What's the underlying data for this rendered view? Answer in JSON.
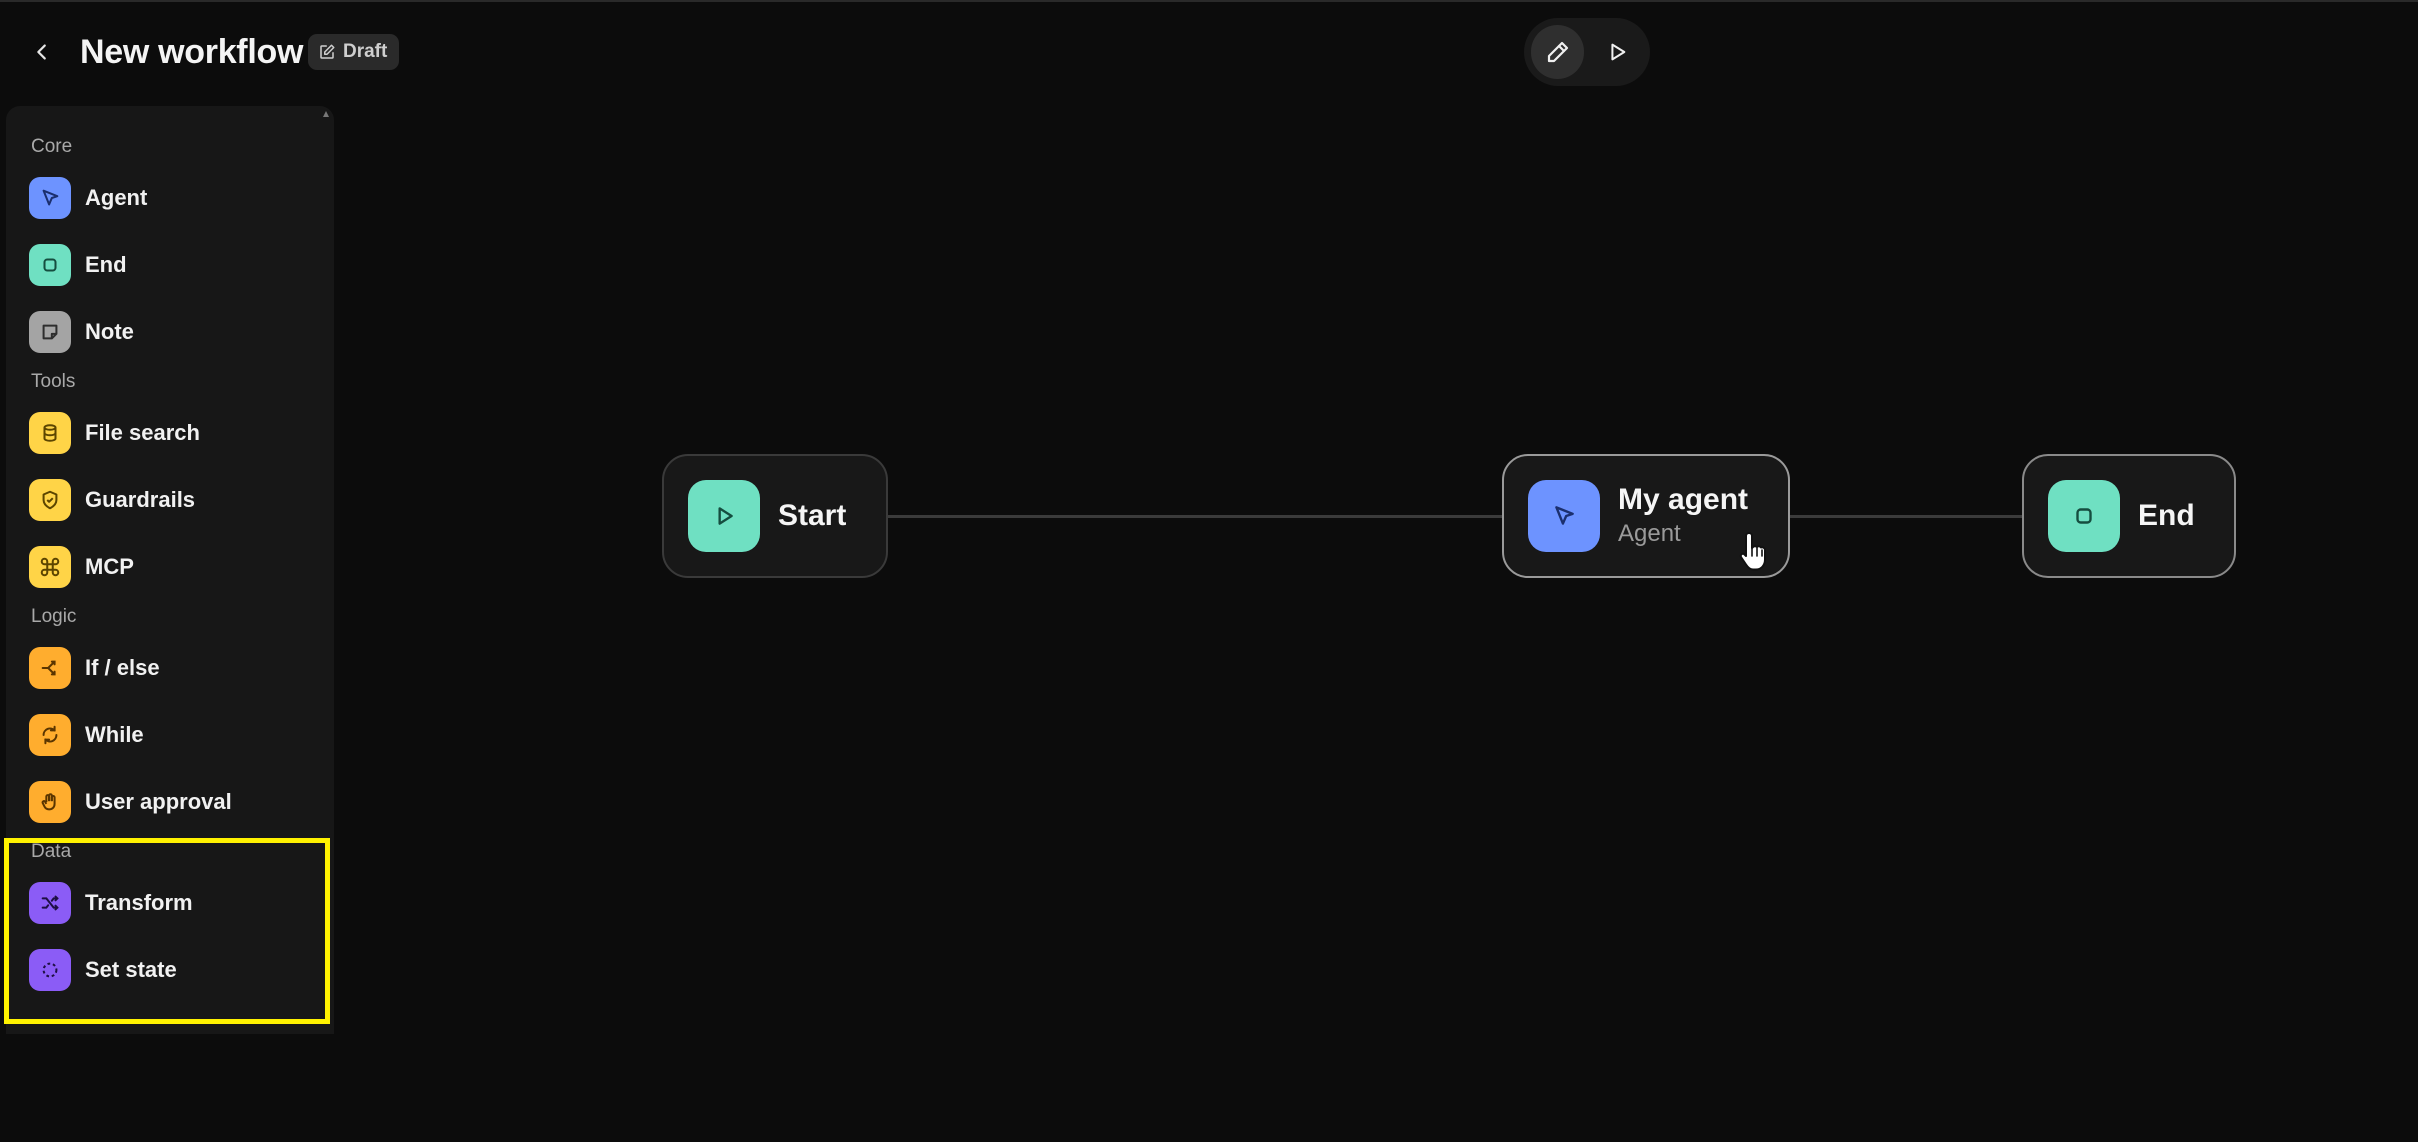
{
  "header": {
    "title": "New workflow",
    "badge": "Draft"
  },
  "toolbar": {
    "edit_icon": "pencil-icon",
    "run_icon": "play-icon"
  },
  "sidebar": {
    "sections": [
      {
        "label": "Core",
        "items": [
          {
            "label": "Agent",
            "icon": "cursor-arrow-icon",
            "color": "#6d93ff"
          },
          {
            "label": "End",
            "icon": "stop-square-icon",
            "color": "#6fe0c2"
          },
          {
            "label": "Note",
            "icon": "note-icon",
            "color": "#a4a4a4"
          }
        ]
      },
      {
        "label": "Tools",
        "items": [
          {
            "label": "File search",
            "icon": "database-icon",
            "color": "#ffd447"
          },
          {
            "label": "Guardrails",
            "icon": "shield-check-icon",
            "color": "#ffd447"
          },
          {
            "label": "MCP",
            "icon": "command-icon",
            "color": "#ffd447"
          }
        ]
      },
      {
        "label": "Logic",
        "items": [
          {
            "label": "If / else",
            "icon": "branch-icon",
            "color": "#ffad2e"
          },
          {
            "label": "While",
            "icon": "loop-icon",
            "color": "#ffad2e"
          },
          {
            "label": "User approval",
            "icon": "hand-icon",
            "color": "#ffad2e"
          }
        ]
      },
      {
        "label": "Data",
        "items": [
          {
            "label": "Transform",
            "icon": "shuffle-icon",
            "color": "#8b5cf6"
          },
          {
            "label": "Set state",
            "icon": "dashed-circle-icon",
            "color": "#8b5cf6"
          }
        ]
      }
    ]
  },
  "canvas": {
    "nodes": [
      {
        "id": "start",
        "title": "Start",
        "icon": "play-icon",
        "color": "#6fe0c2"
      },
      {
        "id": "agent",
        "title": "My agent",
        "subtitle": "Agent",
        "icon": "cursor-arrow-icon",
        "color": "#6d93ff"
      },
      {
        "id": "end",
        "title": "End",
        "icon": "stop-square-icon",
        "color": "#6fe0c2"
      }
    ]
  }
}
